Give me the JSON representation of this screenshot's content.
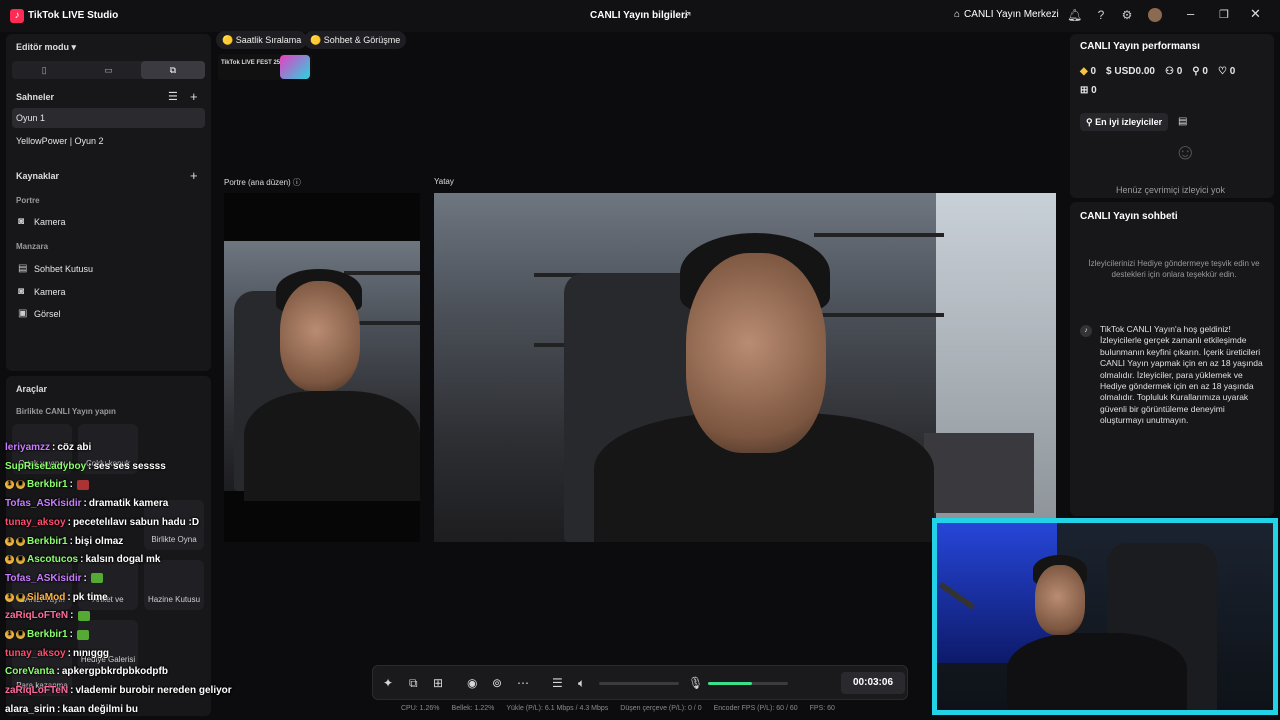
{
  "titlebar": {
    "app_name": "TikTok LIVE Studio",
    "stream_info": "CANLI Yayın bilgileri",
    "live_center": "CANLI Yayın Merkezi"
  },
  "left": {
    "editor_mode": "Editör modu",
    "scenes_title": "Sahneler",
    "scenes": [
      "Oyun 1",
      "YellowPower | Oyun 2"
    ],
    "sources_title": "Kaynaklar",
    "portrait_label": "Portre",
    "portrait_sources": [
      "Kamera"
    ],
    "landscape_label": "Manzara",
    "landscape_sources": [
      "Sohbet Kutusu",
      "Kamera",
      "Görsel"
    ],
    "tools_title": "Araçlar",
    "tools_sub": "Birlikte CANLI Yayın yapın",
    "tools": [
      "Ortak yayıncı",
      "Çoklu konuk",
      "Birlikte Oyna",
      "CANLI Yayın",
      "Anket ve",
      "Hazine Kutusu",
      "Hediye Galerisi",
      "Para kazanma"
    ]
  },
  "badges": [
    "Saatlik Sıralama",
    "Sohbet & Görüşme"
  ],
  "fest_text": "TikTok LIVE FEST 25",
  "preview": {
    "portrait_label": "Portre (ana düzen)",
    "landscape_label": "Yatay"
  },
  "chat": [
    {
      "user": "leriyamzz",
      "msg": "cöz abi",
      "color": "#c77dff"
    },
    {
      "user": "SupRiseLadyboy",
      "msg": "ses ses sessss",
      "color": "#8cff6e"
    },
    {
      "user": "Berkbir1",
      "msg": "",
      "color": "#8cff6e"
    },
    {
      "user": "Tofas_ASKisidir",
      "msg": "dramatik kamera",
      "color": "#c77dff"
    },
    {
      "user": "tunay_aksoy",
      "msg": "pecetelılavı sabun hadu :D",
      "color": "#ff4d6d"
    },
    {
      "user": "Berkbir1",
      "msg": "bişi olmaz",
      "color": "#8cff6e"
    },
    {
      "user": "Ascotucos",
      "msg": "kalsın dogal mk",
      "color": "#8cff6e"
    },
    {
      "user": "Tofas_ASKisidir",
      "msg": "",
      "color": "#c77dff"
    },
    {
      "user": "SilaMod",
      "msg": "pk time",
      "color": "#ffb347"
    },
    {
      "user": "zaRiqLoFTeN",
      "msg": "",
      "color": "#ff6b9d"
    },
    {
      "user": "Berkbir1",
      "msg": "",
      "color": "#8cff6e"
    },
    {
      "user": "tunay_aksoy",
      "msg": "nınıggg",
      "color": "#ff4d6d"
    },
    {
      "user": "CoreVanta",
      "msg": "apkergpbkrdpbkodpfb",
      "color": "#8cff6e"
    },
    {
      "user": "zaRiqLoFTeN",
      "msg": "vlademir burobir nereden geliyor",
      "color": "#ff6b9d"
    },
    {
      "user": "alara_sirin",
      "msg": "kaan değilmi bu",
      "color": "#ffffff"
    }
  ],
  "controls": {
    "timer": "00:03:06",
    "volume": 0.0,
    "mic_level": 0.55
  },
  "stats": {
    "cpu": "CPU: 1.26%",
    "mem": "Bellek: 1.22%",
    "upload": "Yükle (P/L): 6.1 Mbps / 4.3 Mbps",
    "drop": "Düşen çerçeve (P/L): 0 / 0",
    "encoder": "Encoder FPS (P/L): 60 / 60",
    "fps": "FPS: 60"
  },
  "right": {
    "perf_title": "CANLI Yayın performansı",
    "diamonds": "0",
    "usd": "USD0.00",
    "viewers": "0",
    "followers": "0",
    "likes": "0",
    "gifts": "0",
    "top_viewers": "En iyi izleyiciler",
    "no_viewers": "Henüz çevrimiçi izleyici yok",
    "chat_title": "CANLI Yayın sohbeti",
    "chat_hint": "İzleyicilerinizi Hediye göndermeye teşvik edin ve destekleri için onlara teşekkür edin.",
    "welcome": "TikTok CANLI Yayın'a hoş geldiniz! İzleyicilerle gerçek zamanlı etkileşimde bulunmanın keyfini çıkarın. İçerik üreticileri CANLI Yayın yapmak için en az 18 yaşında olmalıdır. İzleyiciler, para yüklemek ve Hediye göndermek için en az 18 yaşında olmalıdır. Topluluk Kurallarımıza uyarak güvenli bir görüntüleme deneyimi oluşturmayı unutmayın."
  }
}
